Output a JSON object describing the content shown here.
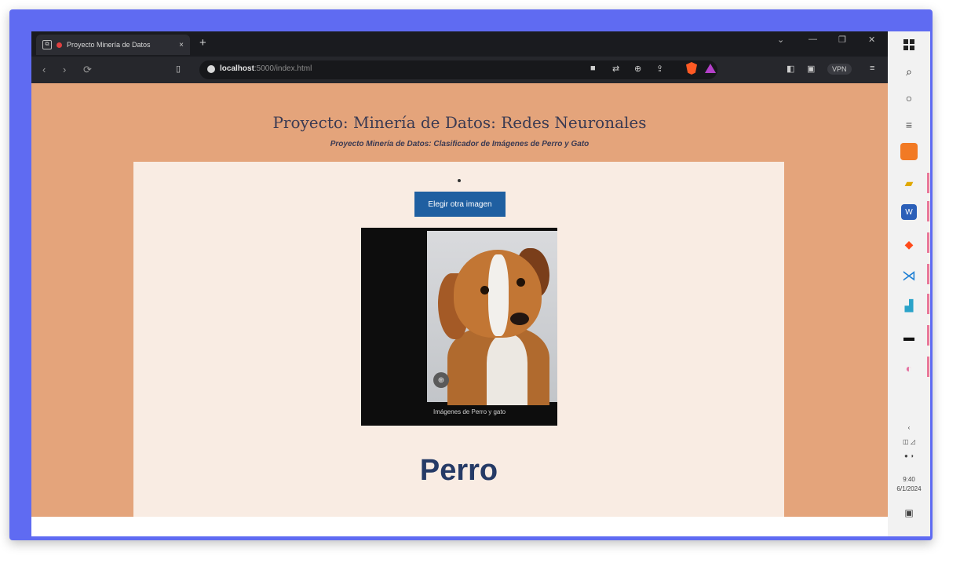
{
  "browser": {
    "tab": {
      "title": "Proyecto Minería de Datos",
      "close": "×"
    },
    "new_tab": "+",
    "window_controls": [
      "⌄",
      "—",
      "❐",
      "✕"
    ],
    "nav": {
      "back": "‹",
      "forward": "›",
      "reload": "⟳"
    },
    "address": {
      "host": "localhost",
      "path": ":5000/index.html"
    },
    "vpn_label": "VPN"
  },
  "page": {
    "title": "Proyecto: Minería de Datos: Redes Neuronales",
    "subtitle": "Proyecto Minería de Datos: Clasificador de Imágenes de Perro y Gato",
    "button_label": "Elegir otra imagen",
    "image_caption": "Imágenes de Perro y gato",
    "image_badge": "⊕",
    "prediction": "Perro"
  },
  "taskbar": {
    "icons": [
      "windows-icon",
      "search-icon",
      "taskview-icon",
      "widgets-icon",
      "app-icon",
      "file-explorer-icon",
      "word-icon",
      "brave-icon",
      "vscode-icon",
      "chart-app-icon",
      "terminal-icon",
      "paint-icon"
    ],
    "clock": "9:40",
    "date": "6/1/2024"
  },
  "colors": {
    "page_bg": "#e4a47b",
    "card_bg": "#f9ece3",
    "button_bg": "#1f5fa1",
    "prediction_text": "#253a66",
    "frame": "#5f6bf2"
  }
}
